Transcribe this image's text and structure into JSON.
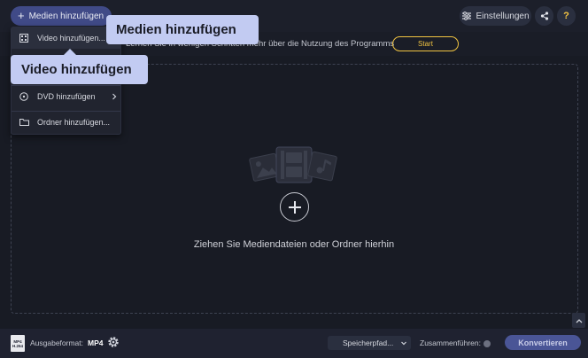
{
  "topbar": {
    "media_button_label": "Medien hinzufügen",
    "settings_label": "Einstellungen",
    "help_label": "?"
  },
  "infobar": {
    "text": "Lernen Sie in wenigen Schritten mehr über die Nutzung des Programms",
    "start_label": "Start"
  },
  "dropzone": {
    "text": "Ziehen Sie Mediendateien oder Ordner hierhin"
  },
  "menu": {
    "items": [
      {
        "label": "Video hinzufügen...",
        "icon": "film-icon",
        "active": true
      },
      {
        "label": "DVD hinzufügen",
        "icon": "disc-icon",
        "has_submenu": true
      },
      {
        "label": "Ordner hinzufügen...",
        "icon": "folder-icon"
      }
    ]
  },
  "tooltips": {
    "media": "Medien hinzufügen",
    "video": "Video hinzufügen"
  },
  "bottombar": {
    "format_icon_top": "MP4",
    "format_icon_bottom": "H.264",
    "format_label": "Ausgabeformat:",
    "format_value": "MP4",
    "save_path_label": "Speicherpfad...",
    "merge_label": "Zusammenführen:",
    "convert_label": "Konvertieren"
  },
  "colors": {
    "accent": "#404a87",
    "start_outline": "#f0c341",
    "tooltip_bg": "#c2cbf2",
    "help_icon": "#f5c542"
  }
}
